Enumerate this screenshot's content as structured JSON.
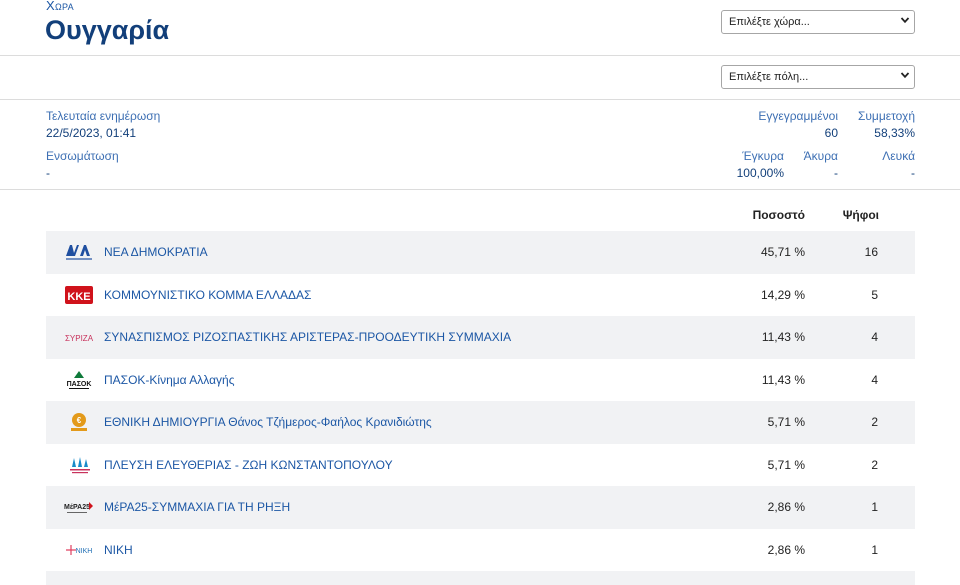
{
  "header": {
    "country_label": "Χωρα",
    "country_name": "Ουγγαρία",
    "country_select": "Επιλέξτε χώρα...",
    "city_select": "Επιλέξτε πόλη..."
  },
  "info": {
    "last_update_label": "Τελευταία ενημέρωση",
    "last_update_value": "22/5/2023, 01:41",
    "incorporation_label": "Ενσωμάτωση",
    "incorporation_value": "-",
    "registered_label": "Εγγεγραμμένοι",
    "registered_value": "60",
    "turnout_label": "Συμμετοχή",
    "turnout_value": "58,33%",
    "valid_label": "Έγκυρα",
    "valid_value": "100,00%",
    "invalid_label": "Άκυρα",
    "invalid_value": "-",
    "blank_label": "Λευκά",
    "blank_value": "-"
  },
  "table": {
    "col_percent": "Ποσοστό",
    "col_votes": "Ψήφοι",
    "rows": [
      {
        "name": "ΝΕΑ ΔΗΜΟΚΡΑΤΙΑ",
        "percent": "45,71 %",
        "votes": "16",
        "logo": "nd-logo",
        "logo_text": "ΝΕΑ ΔΗΜΟΚΡΑΤΙΑ",
        "color": "#1f4fa0"
      },
      {
        "name": "ΚΟΜΜΟΥΝΙΣΤΙΚΟ ΚΟΜΜΑ ΕΛΛΑΔΑΣ",
        "percent": "14,29 %",
        "votes": "5",
        "logo": "kke-logo",
        "logo_text": "ΚΚΕ",
        "color": "#d0121b"
      },
      {
        "name": "ΣΥΝΑΣΠΙΣΜΟΣ ΡΙΖΟΣΠΑΣΤΙΚΗΣ ΑΡΙΣΤΕΡΑΣ-ΠΡΟΟΔΕΥΤΙΚΗ ΣΥΜΜΑΧΙΑ",
        "percent": "11,43 %",
        "votes": "4",
        "logo": "syriza-logo",
        "logo_text": "ΣΥΡΙΖΑ",
        "color": "#c8325c"
      },
      {
        "name": "ΠΑΣΟΚ-Κίνημα Αλλαγής",
        "percent": "11,43 %",
        "votes": "4",
        "logo": "pasok-logo",
        "logo_text": "ΠΑΣΟΚ",
        "color": "#0f7a3a"
      },
      {
        "name": "ΕΘΝΙΚΗ ΔΗΜΙΟΥΡΓΙΑ Θάνος Τζήμερος-Φαήλος Κρανιδιώτης",
        "percent": "5,71 %",
        "votes": "2",
        "logo": "ethniki-dimiourgia-logo",
        "logo_text": "ΕΘΝΙΚΗ ΔΗΜΙΟΥΡΓΙΑ",
        "color": "#e39a1a"
      },
      {
        "name": "ΠΛΕΥΣΗ ΕΛΕΥΘΕΡΙΑΣ - ΖΩΗ ΚΩΝΣΤΑΝΤΟΠΟΥΛΟΥ",
        "percent": "5,71 %",
        "votes": "2",
        "logo": "plefsi-logo",
        "logo_text": "ΠΛΕΥΣΗ ΕΛΕΥΘΕΡΙΑΣ",
        "color": "#1a8bc9"
      },
      {
        "name": "ΜέΡΑ25-ΣΥΜΜΑΧΙΑ ΓΙΑ ΤΗ ΡΗΞΗ",
        "percent": "2,86 %",
        "votes": "1",
        "logo": "mera25-logo",
        "logo_text": "ΜέΡΑ25",
        "color": "#d0121b"
      },
      {
        "name": "ΝΙΚΗ",
        "percent": "2,86 %",
        "votes": "1",
        "logo": "niki-logo",
        "logo_text": "ΝΙΚΗ",
        "color": "#1f6fb5"
      }
    ]
  }
}
